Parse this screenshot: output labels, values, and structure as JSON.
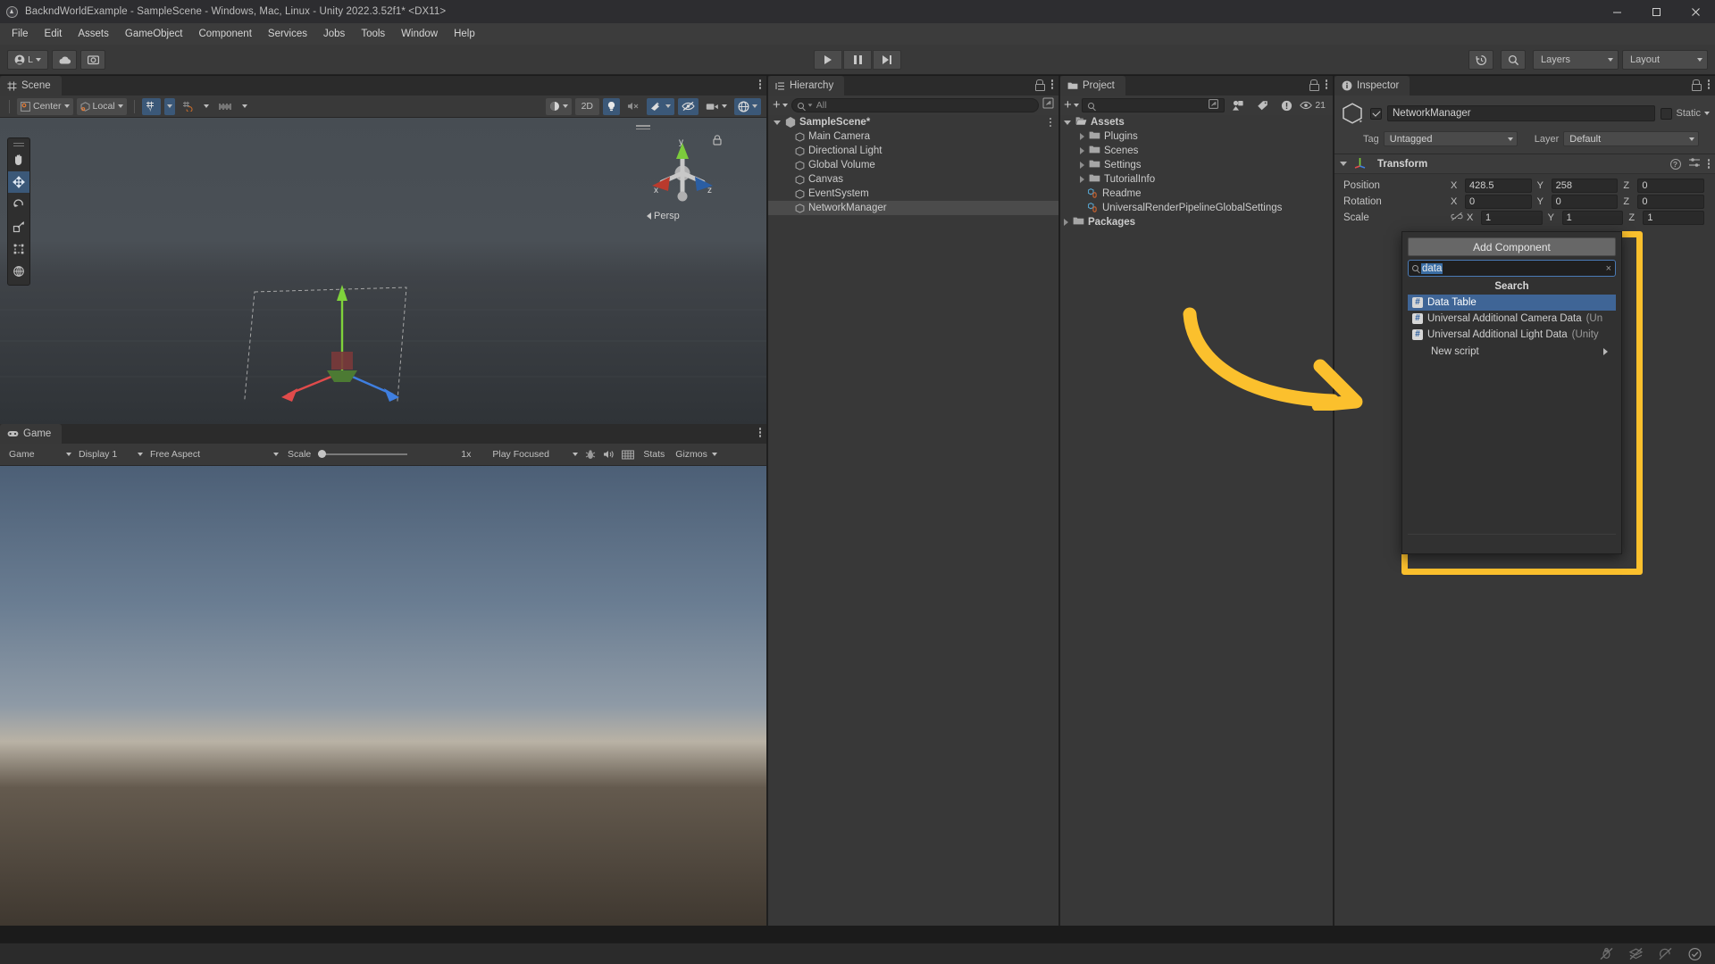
{
  "window": {
    "title": "BackndWorldExample - SampleScene - Windows, Mac, Linux - Unity 2022.3.52f1* <DX11>",
    "minimize_label": "minimize",
    "maximize_label": "maximize",
    "close_label": "close"
  },
  "menubar": {
    "items": [
      "File",
      "Edit",
      "Assets",
      "GameObject",
      "Component",
      "Services",
      "Jobs",
      "Tools",
      "Window",
      "Help"
    ]
  },
  "toolbar": {
    "account_label": "L",
    "cloud_label": "cloud",
    "settings_label": "settings",
    "play_label": "play",
    "pause_label": "pause",
    "step_label": "step",
    "history_label": "history",
    "search_label": "search",
    "layers_label": "Layers",
    "layout_label": "Layout"
  },
  "scene": {
    "tab_label": "Scene",
    "pivot_label": "Center",
    "handle_label": "Local",
    "grid_label": "grid",
    "snap_label": "snap",
    "ruler_label": "ruler",
    "shading_label": "shading",
    "twod_label": "2D",
    "light_label": "light",
    "audio_label": "audio",
    "fx_label": "effects",
    "hidden_label": "hidden",
    "camera_label": "camera",
    "gizmos_label": "gizmos",
    "gizmo_axis_x": "x",
    "gizmo_axis_y": "y",
    "gizmo_axis_z": "z",
    "projection_label": "Persp",
    "tools": [
      "hand-tool",
      "move-tool",
      "rotate-tool",
      "scale-tool",
      "rect-tool",
      "transform-tool"
    ]
  },
  "game": {
    "tab_label": "Game",
    "target_label": "Game",
    "display_label": "Display 1",
    "aspect_label": "Free Aspect",
    "scale_label": "Scale",
    "scale_value": "1x",
    "play_mode_label": "Play Focused",
    "mute_label": "mute",
    "bug_label": "bug",
    "grid_label": "grid",
    "stats_label": "Stats",
    "gizmos_label": "Gizmos"
  },
  "hierarchy": {
    "tab_label": "Hierarchy",
    "search_placeholder": "All",
    "scene_name": "SampleScene*",
    "objects": [
      {
        "name": "Main Camera",
        "selected": false
      },
      {
        "name": "Directional Light",
        "selected": false
      },
      {
        "name": "Global Volume",
        "selected": false
      },
      {
        "name": "Canvas",
        "selected": false
      },
      {
        "name": "EventSystem",
        "selected": false
      },
      {
        "name": "NetworkManager",
        "selected": true
      }
    ]
  },
  "project": {
    "tab_label": "Project",
    "search_placeholder": "",
    "visible_count": "21",
    "root": "Assets",
    "folders": [
      "Plugins",
      "Scenes",
      "Settings",
      "TutorialInfo"
    ],
    "files": [
      "Readme",
      "UniversalRenderPipelineGlobalSettings"
    ],
    "packages": "Packages"
  },
  "inspector": {
    "tab_label": "Inspector",
    "object_name": "NetworkManager",
    "static_label": "Static",
    "tag_label": "Tag",
    "tag_value": "Untagged",
    "layer_label": "Layer",
    "layer_value": "Default",
    "transform": {
      "title": "Transform",
      "rows": [
        {
          "label": "Position",
          "x": "428.5",
          "y": "258",
          "z": "0"
        },
        {
          "label": "Rotation",
          "x": "0",
          "y": "0",
          "z": "0"
        },
        {
          "label": "Scale",
          "x": "1",
          "y": "1",
          "z": "1"
        }
      ],
      "axis_x": "X",
      "axis_y": "Y",
      "axis_z": "Z"
    }
  },
  "add_component": {
    "title": "Add Component",
    "search_value": "data",
    "search_clear_label": "×",
    "section_label": "Search",
    "results": [
      {
        "name": "Data Table",
        "namespace": "",
        "highlighted": true
      },
      {
        "name": "Universal Additional Camera Data",
        "namespace": " (Un",
        "highlighted": false
      },
      {
        "name": "Universal Additional Light Data",
        "namespace": " (Unity",
        "highlighted": false
      }
    ],
    "new_script_label": "New script",
    "highlight_color": "#FBC02D"
  },
  "annotation": {
    "arrow_color": "#FBC02D",
    "arrow_label": "pointer-arrow"
  },
  "statusbar": {
    "icons": [
      "bug-off-icon",
      "layers-off-icon",
      "refresh-off-icon",
      "check-circle-icon"
    ]
  }
}
